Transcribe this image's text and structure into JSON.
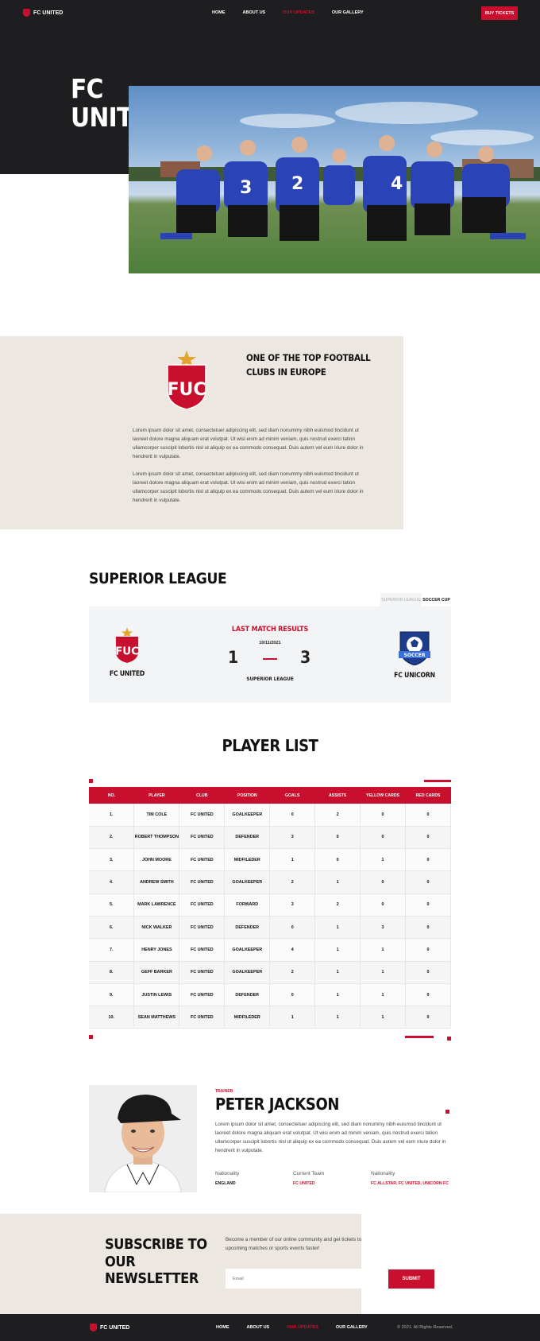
{
  "brand": {
    "name": "FC UNITED",
    "accent": "#c8102e",
    "dark": "#1e1e20"
  },
  "nav": {
    "items": [
      "HOME",
      "ABOUT US",
      "OUR UPDATES",
      "OUR GALLERY"
    ],
    "active": "OUR UPDATES"
  },
  "header": {
    "cta": "BUY TICKETS"
  },
  "hero": {
    "title_line1": "FC",
    "title_line2": "UNITED"
  },
  "about": {
    "heading": "ONE OF THE TOP FOOTBALL CLUBS IN EUROPE",
    "crest_text": "FUC",
    "paragraphs": [
      "Lorem ipsum dolor sit amet, consectetuer adipiscing elit, sed diam nonummy nibh euismod tincidunt ut laoreet dolore magna aliquam erat volutpat. Ut wisi enim ad minim veniam, quis nostrud exerci tation ullamcorper suscipit lobortis nisl ut aliquip ex ea commodo consequat. Duis autem vel eum iriure dolor in hendrerit in vulputate.",
      "Lorem ipsum dolor sit amet, consectetuer adipiscing elit, sed diam nonummy nibh euismod tincidunt ut laoreet dolore magna aliquam erat volutpat. Ut wisi enim ad minim veniam, quis nostrud exerci tation ullamcorper suscipit lobortis nisl ut aliquip ex ea commodo consequat. Duis autem vel eum iriure dolor in hendrerit in vulputate."
    ]
  },
  "league": {
    "title": "SUPERIOR LEAGUE",
    "tabs": [
      "SUPERIOR LEAGUE",
      "SOCCER CUP"
    ],
    "active_tab": "SOCCER CUP",
    "match": {
      "heading": "LAST MATCH RESULTS",
      "date": "10/11/2021",
      "home_team": "FC UNITED",
      "away_team": "FC UNICORN",
      "home_score": "1",
      "away_score": "3",
      "competition": "SUPERIOR LEAGUE",
      "away_crest_text": "SOCCER"
    }
  },
  "players": {
    "title": "PLAYER LIST",
    "columns": [
      "NO.",
      "PLAYER",
      "CLUB",
      "POSITION",
      "GOALS",
      "ASSISTS",
      "YELLOW CARDS",
      "RED CARDS"
    ],
    "rows": [
      [
        "1.",
        "TIM COLE",
        "FC UNITED",
        "GOALKEEPER",
        "0",
        "2",
        "0",
        "0"
      ],
      [
        "2.",
        "ROBERT THOMPSON",
        "FC UNITED",
        "DEFENDER",
        "3",
        "0",
        "0",
        "0"
      ],
      [
        "3.",
        "JOHN MOORE",
        "FC UNITED",
        "MIDFILEDER",
        "1",
        "0",
        "1",
        "0"
      ],
      [
        "4.",
        "ANDREW SMITH",
        "FC UNITED",
        "GOALKEEPER",
        "2",
        "1",
        "0",
        "0"
      ],
      [
        "5.",
        "MARK LAWRENCE",
        "FC UNITED",
        "FORWARD",
        "3",
        "2",
        "0",
        "0"
      ],
      [
        "6.",
        "NICK WALKER",
        "FC UNITED",
        "DEFENDER",
        "0",
        "1",
        "3",
        "0"
      ],
      [
        "7.",
        "HENRY JONES",
        "FC UNITED",
        "GOALKEEPER",
        "4",
        "1",
        "1",
        "0"
      ],
      [
        "8.",
        "GEFF BARKER",
        "FC UNITED",
        "GOALKEEPER",
        "2",
        "1",
        "1",
        "0"
      ],
      [
        "9.",
        "JUSTIN LEWIS",
        "FC UNITED",
        "DEFENDER",
        "0",
        "1",
        "1",
        "0"
      ],
      [
        "10.",
        "SEAN MATTHEWS",
        "FC UNITED",
        "MIDFILEDER",
        "1",
        "1",
        "1",
        "0"
      ]
    ]
  },
  "trainer": {
    "role": "TRAINER",
    "name": "PETER JACKSON",
    "bio": "Lorem ipsum dolor sit amet, consectetuer adipiscing elit, sed diam nonummy nibh euismod tincidunt ut laoreet dolore magna aliquam erat volutpat. Ut wisi enim ad minim veniam, quis nostrud exerci tation ullamcorper suscipit lobortis nisl ut aliquip ex ea commodo consequat. Duis autem vel eum iriure dolor in hendrerit in vulputate.",
    "info": [
      {
        "label": "Nationality",
        "value": "ENGLAND"
      },
      {
        "label": "Current Team",
        "value": "FC UNITED"
      },
      {
        "label": "Nationality",
        "value": "FC ALLSTAR, FC UNITED, UNICORN FC"
      }
    ]
  },
  "newsletter": {
    "title_line1": "SUBSCRIBE TO OUR",
    "title_line2": "NEWSLETTER",
    "text": "Become a member of our online community and get tickets to upcoming matches or sports events faster!",
    "placeholder": "Email",
    "button": "SUBMIT"
  },
  "footer": {
    "copyright": "© 2021. All Rights Reserved."
  },
  "icons": [
    "fc-united-logo-icon",
    "fc-unicorn-crest-icon",
    "star-icon"
  ]
}
